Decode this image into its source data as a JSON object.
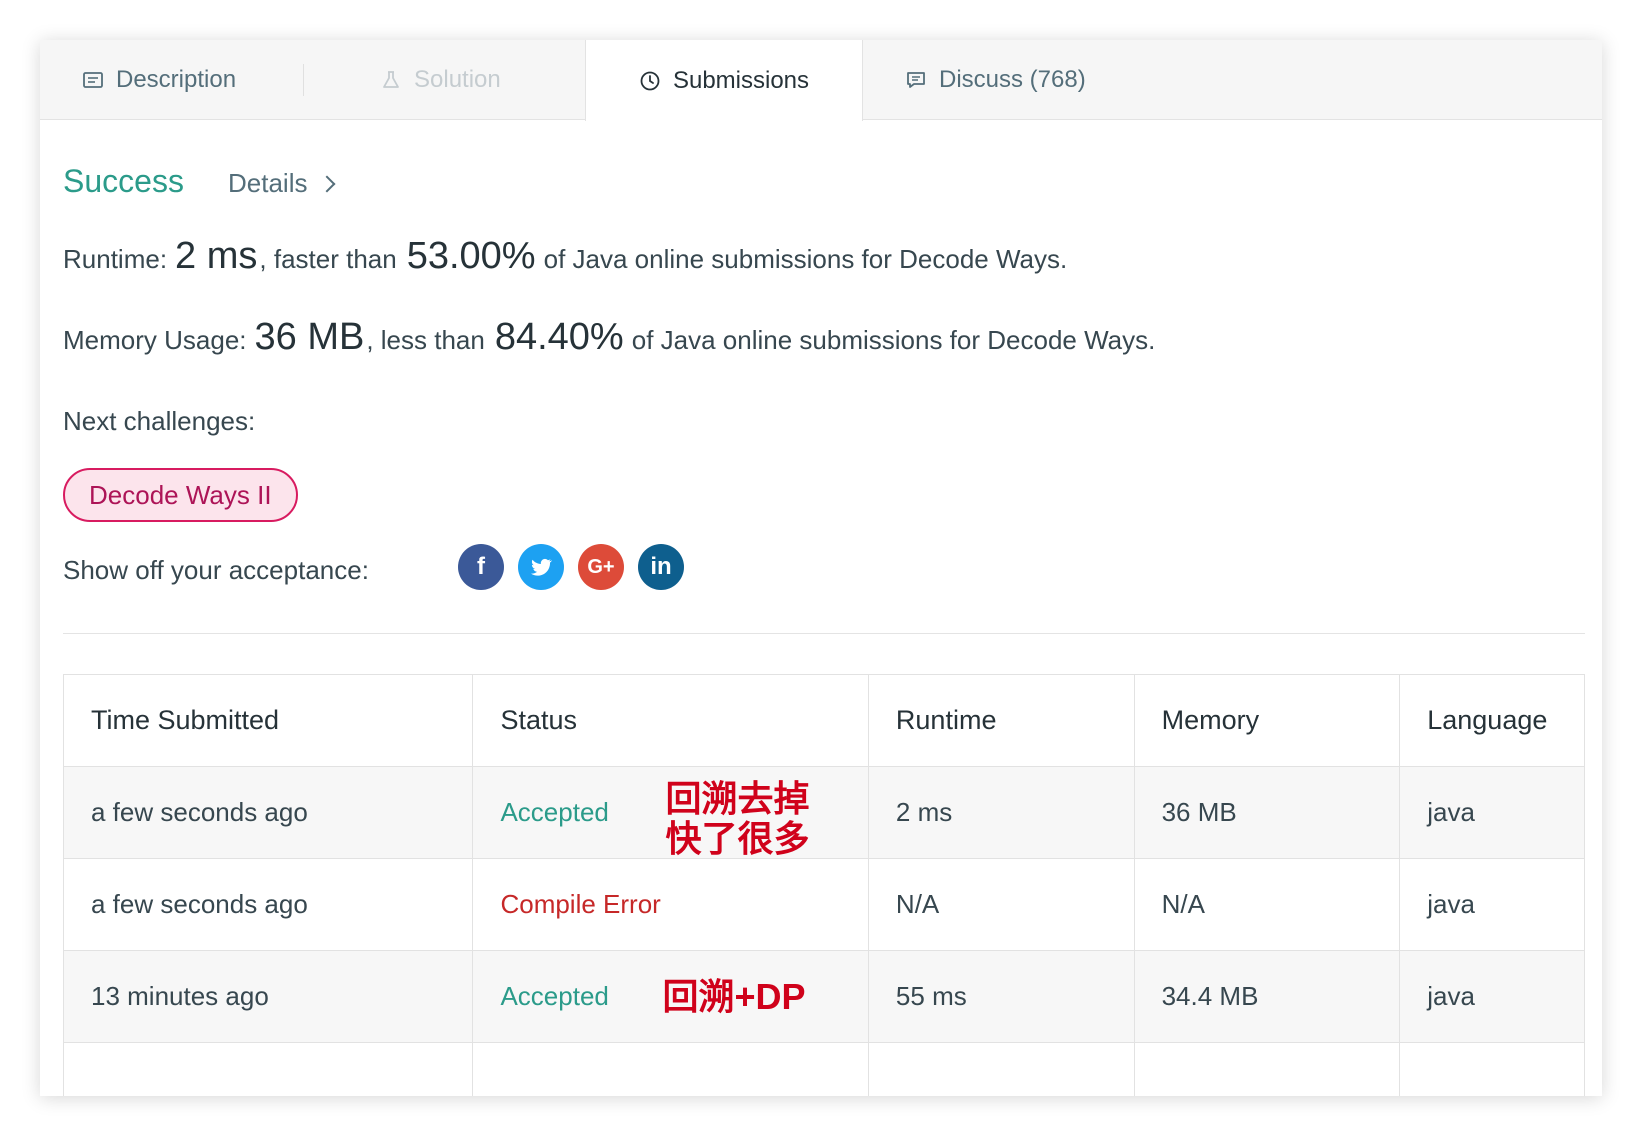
{
  "tabs": [
    {
      "label": "Description",
      "icon": "description-icon"
    },
    {
      "label": "Solution",
      "icon": "flask-icon"
    },
    {
      "label": "Submissions",
      "icon": "clock-icon"
    },
    {
      "label": "Discuss (768)",
      "icon": "comment-icon"
    }
  ],
  "result": {
    "status": "Success",
    "details": "Details",
    "runtime_prefix": "Runtime:",
    "runtime_value": "2 ms",
    "runtime_mid": ", faster than",
    "runtime_pct": "53.00%",
    "runtime_suffix": "of Java online submissions for Decode Ways.",
    "memory_prefix": "Memory Usage:",
    "memory_value": "36 MB",
    "memory_mid": ", less than",
    "memory_pct": "84.40%",
    "memory_suffix": "of Java online submissions for Decode Ways.",
    "next_label": "Next challenges:",
    "next_challenge": "Decode Ways II",
    "share_label": "Show off your acceptance:"
  },
  "social": {
    "facebook": "f",
    "twitter": "t",
    "google": "G+",
    "linkedin": "in"
  },
  "colors": {
    "accent": "#2b9b8a",
    "error": "#c62828",
    "annotation": "#d0021b",
    "challenge_border": "#d81b60",
    "challenge_bg": "#fce4ec"
  },
  "table": {
    "headers": [
      "Time Submitted",
      "Status",
      "Runtime",
      "Memory",
      "Language"
    ],
    "rows": [
      {
        "time": "a few seconds ago",
        "status": "Accepted",
        "runtime": "2 ms",
        "memory": "36 MB",
        "language": "java",
        "note": "回溯去掉\n快了很多"
      },
      {
        "time": "a few seconds ago",
        "status": "Compile Error",
        "runtime": "N/A",
        "memory": "N/A",
        "language": "java",
        "note": ""
      },
      {
        "time": "13 minutes ago",
        "status": "Accepted",
        "runtime": "55 ms",
        "memory": "34.4 MB",
        "language": "java",
        "note": "回溯+DP"
      }
    ]
  }
}
